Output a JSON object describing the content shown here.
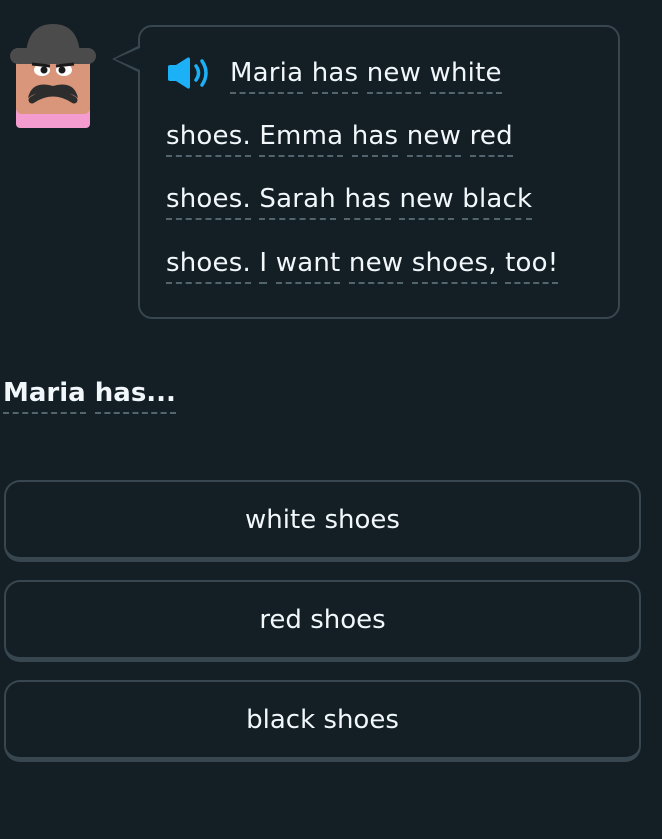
{
  "story": {
    "line1": [
      "Maria",
      "has",
      "new",
      "white"
    ],
    "line2": [
      "shoes.",
      "Emma",
      "has",
      "new",
      "red"
    ],
    "line3": [
      "shoes.",
      "Sarah",
      "has",
      "new",
      "black"
    ],
    "line4": [
      "shoes.",
      "I",
      "want",
      "new",
      "shoes,",
      "too!"
    ]
  },
  "question": [
    "Maria",
    "has..."
  ],
  "options": [
    {
      "label": "white shoes"
    },
    {
      "label": "red shoes"
    },
    {
      "label": "black shoes"
    }
  ],
  "colors": {
    "background": "#131f24",
    "border": "#37464f",
    "text": "#f1f7fb",
    "speaker": "#1cb0f6"
  },
  "icons": {
    "speaker": "speaker-icon",
    "character": "character-avatar"
  }
}
